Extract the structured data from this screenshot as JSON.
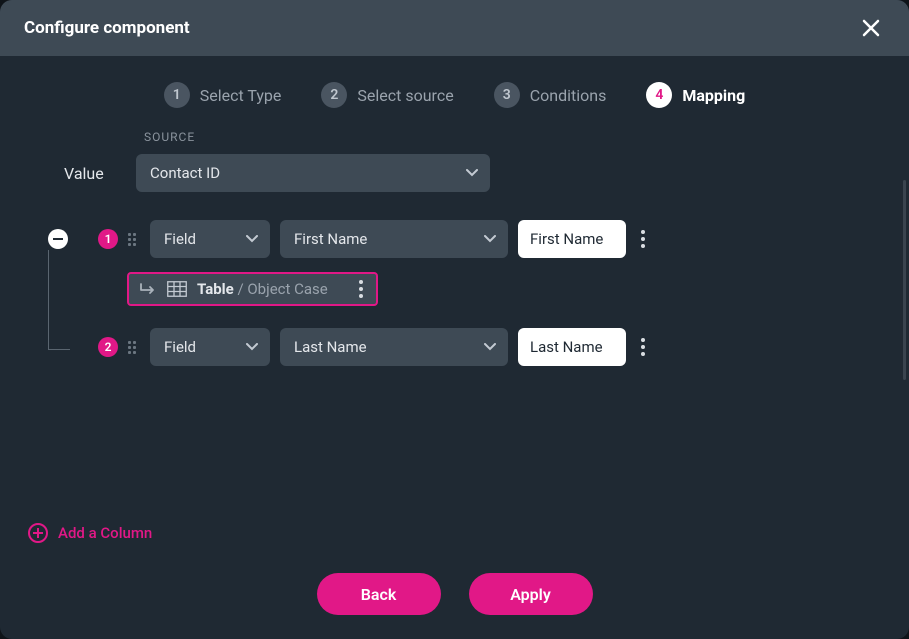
{
  "header": {
    "title": "Configure component"
  },
  "steps": [
    {
      "num": "1",
      "label": "Select Type",
      "active": false
    },
    {
      "num": "2",
      "label": "Select source",
      "active": false
    },
    {
      "num": "3",
      "label": "Conditions",
      "active": false
    },
    {
      "num": "4",
      "label": "Mapping",
      "active": true
    }
  ],
  "source": {
    "section_label": "SOURCE",
    "value_label": "Value",
    "value_selected": "Contact ID"
  },
  "rows": [
    {
      "num": "1",
      "type": "Field",
      "source_field": "First Name",
      "input_value": "First Name",
      "nested": {
        "prefix": "Table",
        "suffix": " / Object Case"
      }
    },
    {
      "num": "2",
      "type": "Field",
      "source_field": "Last Name",
      "input_value": "Last Name"
    }
  ],
  "add_column": "Add a Column",
  "footer": {
    "back": "Back",
    "apply": "Apply"
  }
}
